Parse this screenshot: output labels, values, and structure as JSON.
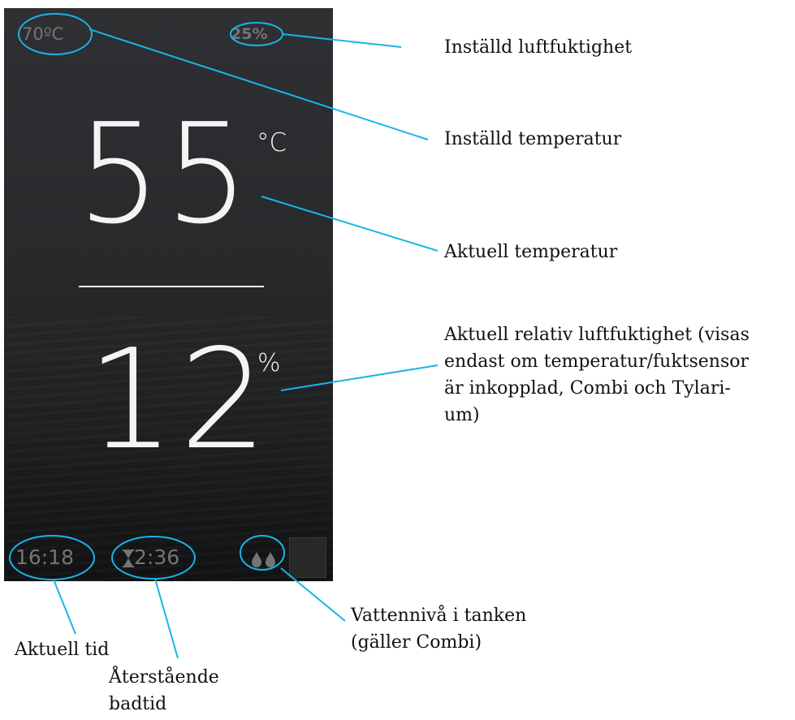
{
  "display": {
    "set_temperature": "70ºC",
    "set_humidity": "25%",
    "current_temperature": "55",
    "temperature_unit": "°C",
    "current_humidity": "12",
    "humidity_unit": "%",
    "clock": "16:18",
    "remaining_time": "2:36",
    "icons": {
      "hourglass": "hourglass-icon",
      "water_level": "water-drops-icon",
      "button": "square-button"
    }
  },
  "labels": {
    "set_humidity": "Inställd luftfuktighet",
    "set_temperature": "Inställd temperatur",
    "current_temperature": "Aktuell temperatur",
    "current_humidity": [
      "Aktuell relativ luftfuktighet (visas",
      "endast om temperatur/fuktsensor",
      "är inkopplad, Combi och Tylari-",
      "um)"
    ],
    "current_time": "Aktuell tid",
    "remaining_bath_time": [
      "Återstående",
      "badtid"
    ],
    "water_level": [
      "Vattennivå i tanken",
      "(gäller Combi)"
    ]
  },
  "colors": {
    "callout": "#1ab4e8",
    "screen_background": "#27292b",
    "display_text": "#f4f4f4",
    "dim_text": "#757575"
  }
}
